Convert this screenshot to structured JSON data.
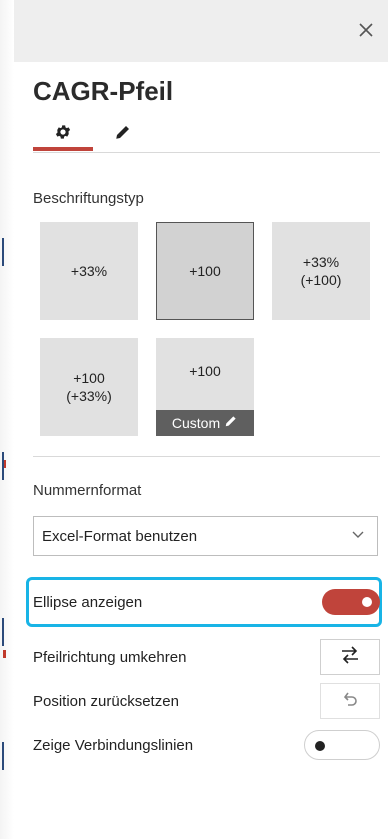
{
  "panel": {
    "close_icon": "close-icon",
    "title": "CAGR-Pfeil",
    "tabs": [
      {
        "icon": "gear-icon",
        "active": true
      },
      {
        "icon": "pencil-icon",
        "active": false
      }
    ]
  },
  "label_type": {
    "heading": "Beschriftungstyp",
    "tiles": [
      {
        "line1": "+33%",
        "line2": ""
      },
      {
        "line1": "+100",
        "line2": "",
        "selected": true
      },
      {
        "line1": "+33%",
        "line2": "(+100)"
      },
      {
        "line1": "+100",
        "line2": "(+33%)"
      },
      {
        "line1": "+100",
        "line2": ""
      }
    ],
    "custom_label": "Custom"
  },
  "number_format": {
    "heading": "Nummernformat",
    "selected": "Excel-Format benutzen"
  },
  "options": {
    "show_ellipse": {
      "label": "Ellipse anzeigen",
      "enabled": true
    },
    "reverse_arrow": {
      "label": "Pfeilrichtung umkehren",
      "icon": "swap-arrows-icon"
    },
    "reset_position": {
      "label": "Position zurücksetzen",
      "icon": "undo-icon"
    },
    "show_connectors": {
      "label": "Zeige Verbindungslinien",
      "enabled": false
    }
  },
  "colors": {
    "accent": "#c0443b",
    "highlight": "#18b4e6"
  }
}
